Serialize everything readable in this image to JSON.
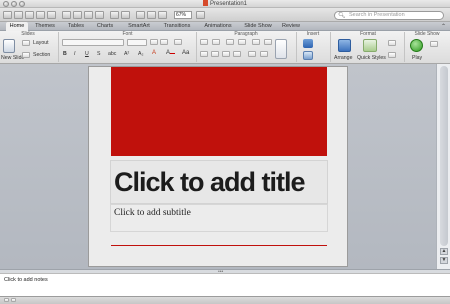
{
  "window": {
    "title": "Presentation1"
  },
  "toolbar": {
    "zoom": "67%",
    "search_placeholder": "Search in Presentation"
  },
  "tabs": [
    "Home",
    "Themes",
    "Tables",
    "Charts",
    "SmartArt",
    "Transitions",
    "Animations",
    "Slide Show",
    "Review"
  ],
  "ribbon": {
    "groups": {
      "slides": "Slides",
      "font": "Font",
      "paragraph": "Paragraph",
      "insert": "Insert",
      "format": "Format",
      "slide_show": "Slide Show"
    },
    "new_slide": "New Slide",
    "layout": "Layout",
    "section": "Section",
    "arrange": "Arrange",
    "quick_styles": "Quick Styles",
    "play": "Play",
    "text_label": "Text"
  },
  "slide": {
    "title_placeholder": "Click to add title",
    "subtitle_placeholder": "Click to add subtitle",
    "accent_color": "#c0110c"
  },
  "notes": {
    "placeholder": "Click to add notes"
  }
}
